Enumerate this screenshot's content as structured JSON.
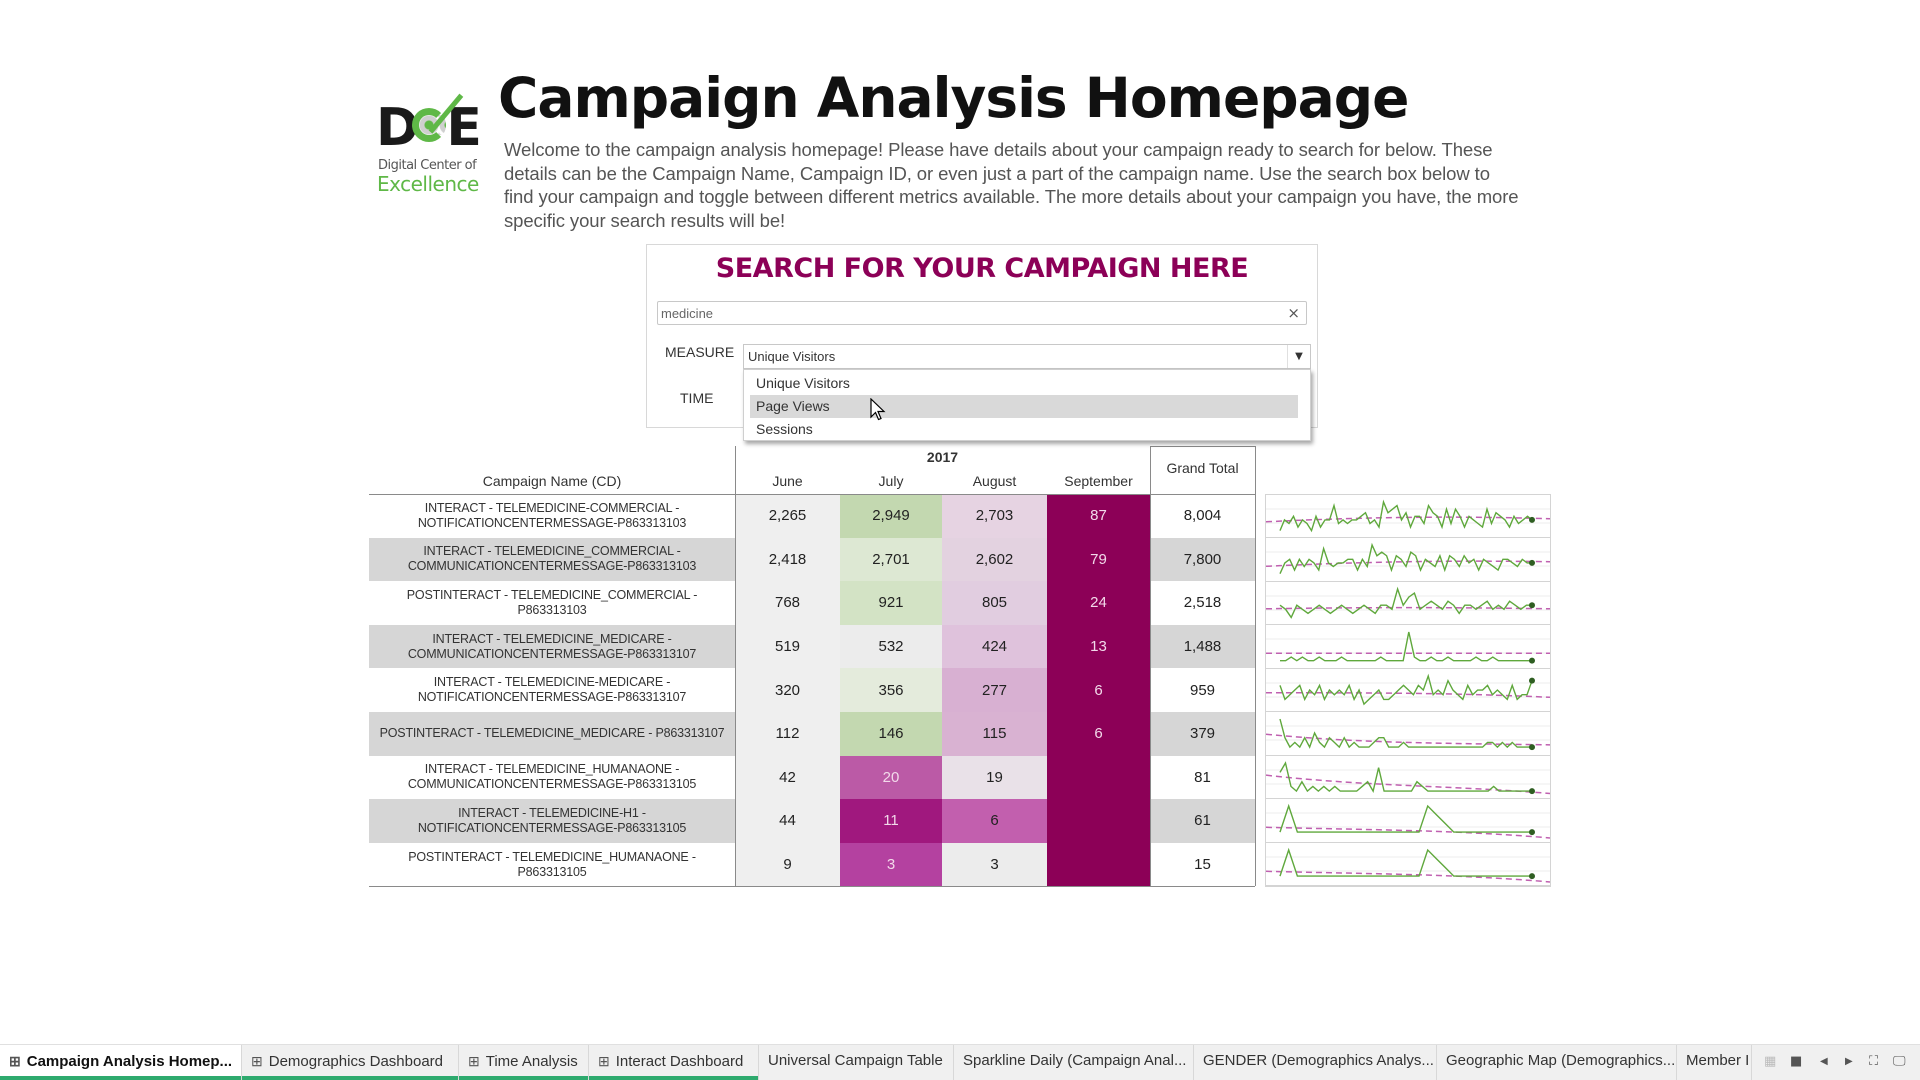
{
  "logo": {
    "mark": "DCE",
    "line1": "Digital Center of",
    "line2": "Excellence"
  },
  "header": {
    "title": "Campaign Analysis Homepage",
    "intro": "Welcome to the campaign analysis homepage!  Please have details about your campaign ready to search for below.  These details can be the Campaign Name, Campaign ID, or even just a part of the campaign name.  Use the search box below to find your campaign and toggle between different metrics available.  The more details about your campaign you have, the more specific your search results will be!"
  },
  "search": {
    "title": "SEARCH FOR YOUR CAMPAIGN HERE",
    "value": "medicine",
    "clear_icon": "×",
    "measure_label": "MEASURE",
    "time_label": "TIME",
    "measure_selected": "Unique Visitors",
    "measure_caret": "▼",
    "measure_options": [
      "Unique Visitors",
      "Page Views",
      "Sessions"
    ],
    "hovered_option": "Page Views"
  },
  "table": {
    "year": "2017",
    "name_header": "Campaign Name (CD)",
    "months": [
      "June",
      "July",
      "August",
      "September"
    ],
    "total_header": "Grand Total",
    "rows": [
      {
        "name": [
          "INTERACT - TELEMEDICINE-COMMERCIAL -",
          "NOTIFICATIONCENTERMESSAGE-P863313103"
        ],
        "values": [
          "2,265",
          "2,949",
          "2,703",
          "87"
        ],
        "total": "8,004"
      },
      {
        "name": [
          "INTERACT - TELEMEDICINE_COMMERCIAL -",
          "COMMUNICATIONCENTERMESSAGE-P863313103"
        ],
        "values": [
          "2,418",
          "2,701",
          "2,602",
          "79"
        ],
        "total": "7,800"
      },
      {
        "name": [
          "POSTINTERACT - TELEMEDICINE_COMMERCIAL -",
          "P863313103"
        ],
        "values": [
          "768",
          "921",
          "805",
          "24"
        ],
        "total": "2,518"
      },
      {
        "name": [
          "INTERACT - TELEMEDICINE_MEDICARE -",
          "COMMUNICATIONCENTERMESSAGE-P863313107"
        ],
        "values": [
          "519",
          "532",
          "424",
          "13"
        ],
        "total": "1,488"
      },
      {
        "name": [
          "INTERACT - TELEMEDICINE-MEDICARE -",
          "NOTIFICATIONCENTERMESSAGE-P863313107"
        ],
        "values": [
          "320",
          "356",
          "277",
          "6"
        ],
        "total": "959"
      },
      {
        "name": [
          "POSTINTERACT - TELEMEDICINE_MEDICARE - P863313107"
        ],
        "values": [
          "112",
          "146",
          "115",
          "6"
        ],
        "total": "379"
      },
      {
        "name": [
          "INTERACT - TELEMEDICINE_HUMANAONE -",
          "COMMUNICATIONCENTERMESSAGE-P863313105"
        ],
        "values": [
          "42",
          "20",
          "19",
          ""
        ],
        "total": "81"
      },
      {
        "name": [
          "INTERACT - TELEMEDICINE-H1 -",
          "NOTIFICATIONCENTERMESSAGE-P863313105"
        ],
        "values": [
          "44",
          "11",
          "6",
          ""
        ],
        "total": "61"
      },
      {
        "name": [
          "POSTINTERACT - TELEMEDICINE_HUMANAONE -",
          "P863313105"
        ],
        "values": [
          "9",
          "3",
          "3",
          ""
        ],
        "total": "15"
      }
    ],
    "cell_colors": [
      [
        "#efefef",
        "#c3d8b0",
        "#e6d3e2",
        "#8c0057"
      ],
      [
        "#efefef",
        "#dde8d3",
        "#e3d2e0",
        "#8c0057"
      ],
      [
        "#efefef",
        "#d3e3c5",
        "#e1cde0",
        "#8c0057"
      ],
      [
        "#efefef",
        "#ececec",
        "#dfc2dc",
        "#8c0057"
      ],
      [
        "#efefef",
        "#e4ebdc",
        "#d8b0d2",
        "#8c0057"
      ],
      [
        "#efefef",
        "#c3d8b0",
        "#d9b2d2",
        "#8c0057"
      ],
      [
        "#efefef",
        "#bb5aa6",
        "#e9e1e8",
        "#8c0057"
      ],
      [
        "#efefef",
        "#a0187e",
        "#c25fae",
        "#8c0057"
      ],
      [
        "#efefef",
        "#b441a0",
        "#ececec",
        "#8c0057"
      ]
    ],
    "dark_text": [
      [
        false,
        false,
        false,
        true
      ],
      [
        false,
        false,
        false,
        true
      ],
      [
        false,
        false,
        false,
        true
      ],
      [
        false,
        false,
        false,
        true
      ],
      [
        false,
        false,
        false,
        true
      ],
      [
        false,
        false,
        false,
        true
      ],
      [
        false,
        true,
        false,
        true
      ],
      [
        false,
        true,
        false,
        true
      ],
      [
        false,
        true,
        false,
        true
      ]
    ]
  },
  "sparklines": {
    "line_color": "#5fa83c",
    "trend_color": "#c060b0",
    "series": [
      [
        2,
        5,
        4,
        6,
        3,
        5,
        4,
        2,
        6,
        3,
        5,
        5,
        9,
        4,
        5,
        4,
        5,
        5,
        6,
        7,
        4,
        5,
        3,
        10,
        7,
        8,
        9,
        5,
        7,
        3,
        6,
        6,
        4,
        9,
        7,
        6,
        3,
        8,
        4,
        8,
        6,
        3,
        6,
        5,
        4,
        3,
        8,
        4,
        7,
        6,
        5,
        3,
        6,
        4,
        5,
        6,
        5
      ],
      [
        2,
        5,
        6,
        3,
        6,
        4,
        6,
        5,
        3,
        9,
        5,
        4,
        5,
        5,
        6,
        6,
        3,
        6,
        4,
        10,
        7,
        8,
        7,
        3,
        7,
        6,
        4,
        8,
        7,
        3,
        6,
        5,
        4,
        7,
        3,
        7,
        6,
        4,
        7,
        5,
        6,
        3,
        6,
        5,
        4,
        3,
        6,
        6,
        5,
        4,
        6,
        5,
        5
      ],
      [
        5,
        4,
        2,
        5,
        4,
        3,
        4,
        5,
        4,
        3,
        4,
        5,
        4,
        3,
        4,
        5,
        4,
        3,
        5,
        5,
        4,
        9,
        5,
        7,
        8,
        4,
        5,
        6,
        5,
        4,
        6,
        5,
        3,
        5,
        5,
        4,
        5,
        6,
        4,
        5,
        4,
        6,
        5,
        4,
        5,
        5
      ],
      [
        2,
        2,
        3,
        2,
        3,
        2,
        2,
        3,
        2,
        2,
        2,
        3,
        2,
        2,
        2,
        2,
        2,
        2,
        3,
        2,
        2,
        2,
        2,
        10,
        3,
        2,
        2,
        3,
        2,
        2,
        3,
        2,
        2,
        2,
        2,
        3,
        2,
        2,
        3,
        2,
        2,
        2,
        2,
        2,
        2,
        2
      ],
      [
        6,
        3,
        4,
        5,
        6,
        3,
        5,
        4,
        6,
        3,
        5,
        4,
        5,
        4,
        6,
        3,
        5,
        2,
        3,
        4,
        5,
        3,
        3,
        4,
        5,
        6,
        5,
        4,
        6,
        5,
        8,
        4,
        5,
        4,
        7,
        5,
        4,
        3,
        6,
        4,
        5,
        5,
        6,
        4,
        5,
        4,
        3,
        6,
        3,
        4,
        4,
        7
      ],
      [
        8,
        4,
        2,
        3,
        2,
        4,
        2,
        5,
        3,
        2,
        4,
        3,
        2,
        4,
        2,
        3,
        2,
        2,
        2,
        3,
        4,
        4,
        2,
        2,
        2,
        3,
        2,
        2,
        2,
        2,
        2,
        2,
        2,
        2,
        2,
        2,
        2,
        2,
        2,
        2,
        2,
        2,
        3,
        3,
        2,
        3,
        2,
        3,
        2,
        2,
        2,
        2
      ],
      [
        6,
        8,
        3,
        2,
        4,
        2,
        3,
        2,
        3,
        2,
        3,
        2,
        2,
        2,
        2,
        3,
        4,
        2,
        7,
        2,
        2,
        2,
        2,
        2,
        2,
        4,
        3,
        2,
        2,
        2,
        2,
        2,
        2,
        2,
        2,
        2,
        2,
        2,
        2,
        3,
        2,
        2,
        2,
        2,
        2,
        2,
        2
      ],
      [
        1,
        4,
        1,
        1,
        1,
        1,
        1,
        1,
        1,
        1,
        1,
        1,
        1,
        1,
        1,
        1,
        1,
        4,
        3,
        2,
        1,
        1,
        1,
        1,
        1,
        1,
        1,
        1,
        1,
        1
      ]
    ],
    "trends": [
      [
        0.35,
        0.5,
        0.55,
        0.45
      ],
      [
        0.3,
        0.45,
        0.5,
        0.45
      ],
      [
        0.35,
        0.4,
        0.4,
        0.35
      ],
      [
        0.3,
        0.3,
        0.3,
        0.3
      ],
      [
        0.45,
        0.45,
        0.45,
        0.3
      ],
      [
        0.5,
        0.2,
        0.2,
        0.15
      ],
      [
        0.6,
        0.25,
        0.25,
        0.0
      ],
      [
        0.3,
        0.22,
        0.22,
        -0.05
      ]
    ]
  },
  "tabs": [
    {
      "label": "Campaign Analysis Homep...",
      "icon": "⊞",
      "active": true
    },
    {
      "label": "Demographics Dashboard",
      "icon": "⊞",
      "active": false
    },
    {
      "label": "Time Analysis",
      "icon": "⊞",
      "active": false
    },
    {
      "label": "Interact Dashboard",
      "icon": "⊞",
      "active": false
    },
    {
      "label": "Universal Campaign  Table",
      "icon": "",
      "active": false
    },
    {
      "label": "Sparkline Daily (Campaign Anal...",
      "icon": "",
      "active": false
    },
    {
      "label": "GENDER (Demographics Analys...",
      "icon": "",
      "active": false
    },
    {
      "label": "Geographic Map (Demographics...",
      "icon": "",
      "active": false
    },
    {
      "label": "Member I",
      "icon": "",
      "active": false
    }
  ],
  "colors": {
    "brand": "#8c0057",
    "tab_accent": "#2eaa6e",
    "logo_green": "#5fb847"
  }
}
